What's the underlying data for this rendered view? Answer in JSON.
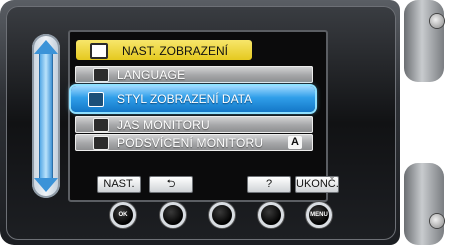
{
  "menu": {
    "title": "NAST. ZOBRAZENÍ",
    "items": [
      {
        "label": "LANGUAGE",
        "icon": "globe-icon"
      },
      {
        "label": "STYL ZOBRAZENÍ DATA",
        "icon": "clock-icon",
        "selected": true
      },
      {
        "label": "JAS MONITORU",
        "icon": "brightness-icon"
      },
      {
        "label": "PODSVÍCENÍ MONITORU",
        "icon": "backlight-icon",
        "badge": "A"
      }
    ]
  },
  "softkeys": {
    "nast": "NAST.",
    "back": "⮌",
    "help": "?",
    "exit": "UKONČ."
  },
  "buttons": {
    "ok": "OK",
    "menu": "MENU"
  },
  "colors": {
    "header_yellow": "#e5c91f",
    "selection_blue": "#1f8fe0",
    "slider_blue": "#3b93d8"
  }
}
